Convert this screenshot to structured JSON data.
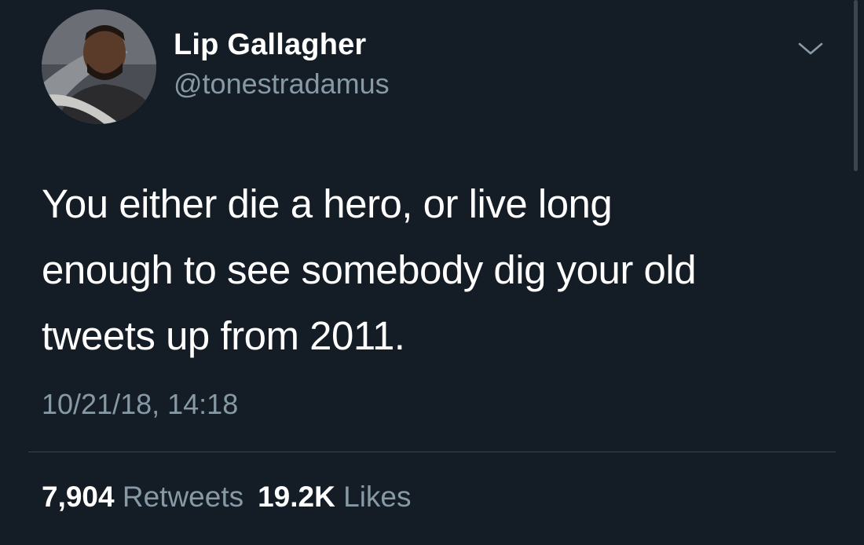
{
  "tweet": {
    "author": {
      "display_name": "Lip Gallagher",
      "handle": "@tonestradamus",
      "avatar_icon": "profile-photo"
    },
    "menu_icon": "chevron-down-icon",
    "text": "You either die a hero, or live long\nenough to see somebody dig your old\ntweets up from 2011.",
    "timestamp": "10/21/18, 14:18",
    "stats": {
      "retweets_count": "7,904",
      "retweets_label": "Retweets",
      "likes_count": "19.2K",
      "likes_label": "Likes"
    }
  },
  "colors": {
    "background": "#141d26",
    "primary_text": "#ffffff",
    "secondary_text": "#8899a6",
    "divider": "#38444d"
  }
}
